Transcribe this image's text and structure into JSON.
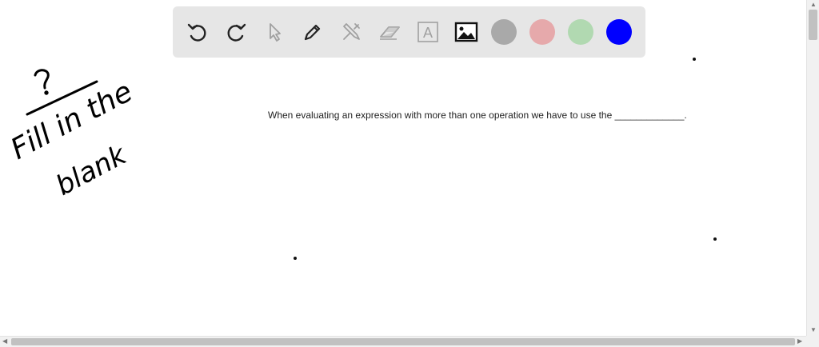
{
  "toolbar": {
    "tools": [
      {
        "name": "undo-icon"
      },
      {
        "name": "redo-icon"
      },
      {
        "name": "pointer-icon"
      },
      {
        "name": "pen-icon"
      },
      {
        "name": "tools-icon"
      },
      {
        "name": "eraser-icon"
      },
      {
        "name": "text-icon",
        "glyph": "A"
      },
      {
        "name": "image-icon"
      }
    ],
    "colors": [
      "#a9a9a9",
      "#e6a9ab",
      "#b1d9b1",
      "#0000ff"
    ]
  },
  "canvas": {
    "problem": "When evaluating an expression with more than one operation we have to use the _____________.",
    "handwriting": {
      "question_mark": "?",
      "line1": "Fill in the",
      "line2": "blank"
    }
  },
  "scrollbars": {
    "up": "▲",
    "down": "▼",
    "left": "◀",
    "right": "▶"
  }
}
